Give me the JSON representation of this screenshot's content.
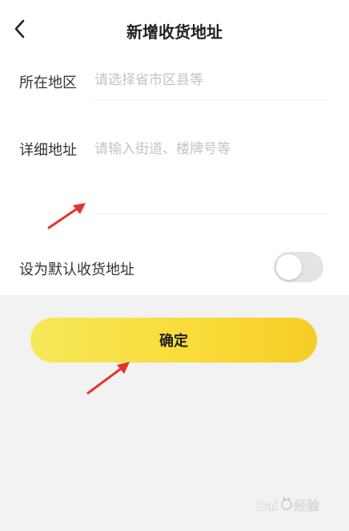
{
  "header": {
    "title": "新增收货地址",
    "back_icon": "chevron-left-icon"
  },
  "form": {
    "region": {
      "label": "所在地区",
      "placeholder": "请选择省市区县等",
      "value": ""
    },
    "address": {
      "label": "详细地址",
      "placeholder": "请输入街道、楼牌号等",
      "value": ""
    },
    "default_address": {
      "label": "设为默认收货地址",
      "enabled": false
    }
  },
  "confirm_button": {
    "label": "确定"
  },
  "colors": {
    "button_gradient_start": "#f7e85a",
    "button_gradient_end": "#f6cd27",
    "page_background": "#f2f2f2",
    "annotation_arrow": "#e5322d"
  },
  "watermark": {
    "text": "Baidu经验"
  }
}
